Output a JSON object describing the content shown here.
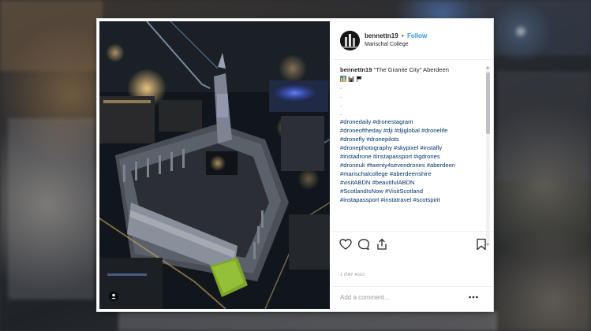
{
  "post": {
    "username": "bennettn19",
    "separator": "•",
    "follow_label": "Follow",
    "location": "Marischal College",
    "caption_username": "bennettn19",
    "caption_text": "\"The Granite City\" Aberdeen",
    "emoji_icons": [
      "cityscape-emoji-icon",
      "castle-emoji-icon",
      "flag-emoji-icon"
    ],
    "dots": [
      ".",
      ".",
      ".",
      "."
    ],
    "hashtag_lines": [
      "#dronedaily #dronestagram",
      "#droneoftheday #dji #djiglobal #dronelife",
      "#dronefly #dronepilots",
      "#dronephotography #skypixel #instafly",
      "#instadrone #instapassport #igdrones",
      "#droneuk #twenty4sevendrones #aberdeen",
      "#marischalcollege #aberdeenshire",
      "#visitABDN #beautifulABDN",
      "#ScotlandIsNow #VisitScotland",
      "#instapassport #instatravel #scotspirit"
    ],
    "timestamp": "1 DAY AGO",
    "comment_placeholder": "Add a comment..."
  },
  "icons": {
    "like": "heart-icon",
    "comment": "comment-icon",
    "share": "share-icon",
    "save": "bookmark-icon",
    "more": "more-options-icon",
    "photo_badge": "user-tag-icon"
  },
  "colors": {
    "link_blue": "#3897f0",
    "hashtag": "#003569",
    "text": "#262626",
    "muted": "#999999"
  }
}
